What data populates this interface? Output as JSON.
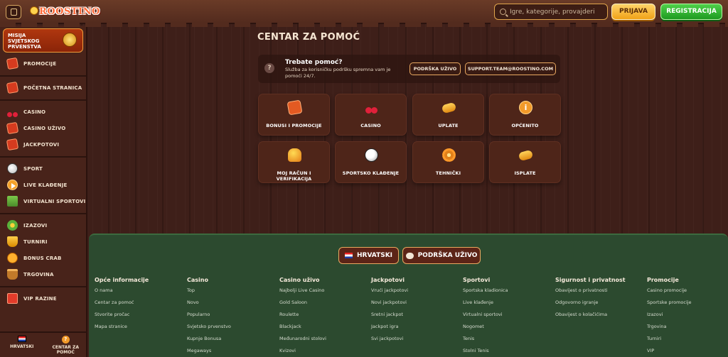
{
  "header": {
    "logo_text": "ROOSTINO",
    "search_placeholder": "Igre, kategorije, provajderi",
    "login_label": "PRIJAVA",
    "register_label": "REGISTRACIJA"
  },
  "sidebar": {
    "mission_label": "MISIJA SVJETSKOG PRVENSTVA",
    "groups": [
      [
        {
          "label": "PROMOCIJE",
          "icon": "promo-icon"
        }
      ],
      [
        {
          "label": "POČETNA STRANICA",
          "icon": "home-icon"
        }
      ],
      [
        {
          "label": "CASINO",
          "icon": "cherry-icon"
        },
        {
          "label": "CASINO UŽIVO",
          "icon": "cards-icon"
        },
        {
          "label": "JACKPOTOVI",
          "icon": "jackpot-icon"
        }
      ],
      [
        {
          "label": "SPORT",
          "icon": "soccer-ball-icon"
        },
        {
          "label": "LIVE KLAĐENJE",
          "icon": "play-icon"
        },
        {
          "label": "VIRTUALNI SPORTOVI",
          "icon": "flag-icon"
        }
      ],
      [
        {
          "label": "IZAZOVI",
          "icon": "flower-icon"
        },
        {
          "label": "TURNIRI",
          "icon": "trophy-icon"
        },
        {
          "label": "BONUS CRAB",
          "icon": "crab-icon"
        },
        {
          "label": "TRGOVINA",
          "icon": "basket-icon"
        }
      ],
      [
        {
          "label": "VIP RAZINE",
          "icon": "gift-icon"
        }
      ]
    ],
    "bottom_language": "HRVATSKI",
    "bottom_help": "CENTAR ZA POMOĆ"
  },
  "main": {
    "title": "CENTAR ZA POMOĆ",
    "help": {
      "title": "Trebate pomoć?",
      "description": "Služba za korisničku podršku spremna vam je pomoći 24/7.",
      "live_support_label": "PODRŠKA UŽIVO",
      "email_label": "SUPPORT.TEAM@ROOSTINO.COM"
    },
    "tiles": [
      {
        "label": "BONUSI I PROMOCIJE",
        "icon": "bonus-icon"
      },
      {
        "label": "CASINO",
        "icon": "cherry-icon"
      },
      {
        "label": "UPLATE",
        "icon": "coin-icon"
      },
      {
        "label": "OPĆENITO",
        "icon": "info-icon"
      },
      {
        "label": "MOJ RAČUN I VERIFIKACIJA",
        "icon": "rooster-icon"
      },
      {
        "label": "SPORTSKO KLAĐENJE",
        "icon": "soccer-ball-icon"
      },
      {
        "label": "TEHNIČKI",
        "icon": "gear-icon"
      },
      {
        "label": "ISPLATE",
        "icon": "coins-icon"
      }
    ]
  },
  "footer": {
    "language_label": "HRVATSKI",
    "support_label": "PODRŠKA UŽIVO",
    "columns": [
      {
        "title": "Opće informacije",
        "links": [
          "O nama",
          "Centar za pomoć",
          "Stvorite pročac",
          "Mapa stranice"
        ]
      },
      {
        "title": "Casino",
        "links": [
          "Top",
          "Novo",
          "Popularno",
          "Svjetsko prvenstvo",
          "Kupnje Bonusa",
          "Megaways"
        ]
      },
      {
        "title": "Casino uživo",
        "links": [
          "Najbolji Live Casino",
          "Gold Saloon",
          "Roulette",
          "Blackjack",
          "Međunarodni stolovi",
          "Kvizovi"
        ]
      },
      {
        "title": "Jackpotovi",
        "links": [
          "Vrući jackpotovi",
          "Novi jackpotovi",
          "Sretni jackpot",
          "Jackpot igra",
          "Svi jackpotovi"
        ]
      },
      {
        "title": "Sportovi",
        "links": [
          "Sportska kladionica",
          "Live klađenje",
          "Virtualni sportovi",
          "Nogomet",
          "Tenis",
          "Stolni Tenis"
        ]
      },
      {
        "title": "Sigurnost i privatnost",
        "links": [
          "Obavijest o privatnosti",
          "Odgovorno igranje",
          "Obavijest o kolačićima"
        ]
      },
      {
        "title": "Promocije",
        "links": [
          "Casino promocije",
          "Sportske promocije",
          "Izazovi",
          "Trgovina",
          "Turniri",
          "VIP"
        ]
      }
    ]
  },
  "colors": {
    "accent_orange": "#e9a961",
    "login_yellow": "#f0a217",
    "register_green": "#1e9a20",
    "footer_green": "#2c4a2f"
  }
}
